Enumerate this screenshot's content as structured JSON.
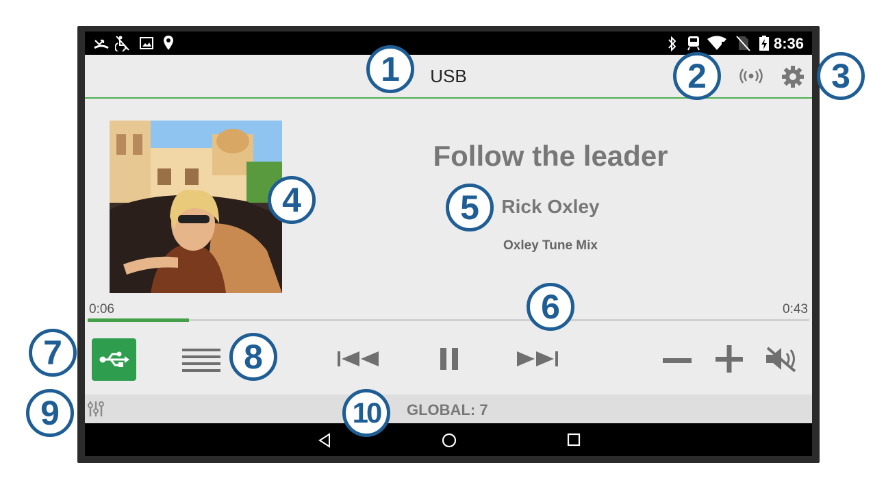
{
  "status_bar": {
    "time": "8:36",
    "left_icons": [
      "missed-call-icon",
      "no-accessibility-icon",
      "image-icon",
      "location-pin-icon"
    ],
    "right_icons": [
      "bluetooth-icon",
      "transit-icon",
      "wifi-icon",
      "no-sim-icon",
      "battery-charging-icon"
    ]
  },
  "header": {
    "source_title": "USB",
    "icons": [
      "broadcast-icon",
      "settings-gear-icon"
    ]
  },
  "now_playing": {
    "title": "Follow the leader",
    "artist": "Rick Oxley",
    "album": "Oxley Tune Mix",
    "elapsed": "0:06",
    "duration": "0:43",
    "progress_fraction": 0.14
  },
  "controls": {
    "source_icon": "usb-icon",
    "accent_color": "#2e9d4e",
    "buttons": [
      "menu-list-icon",
      "previous-track-icon",
      "pause-icon",
      "next-track-icon",
      "volume-down-icon",
      "volume-up-icon",
      "mute-icon"
    ]
  },
  "zone_bar": {
    "label": "GLOBAL: 7",
    "icon": "equalizer-sliders-icon"
  },
  "nav_bar": {
    "icons": [
      "back-triangle-icon",
      "home-circle-icon",
      "recents-square-icon"
    ]
  },
  "callouts": [
    "1",
    "2",
    "3",
    "4",
    "5",
    "6",
    "7",
    "8",
    "9",
    "10"
  ],
  "callout_color": "#1f5e95"
}
